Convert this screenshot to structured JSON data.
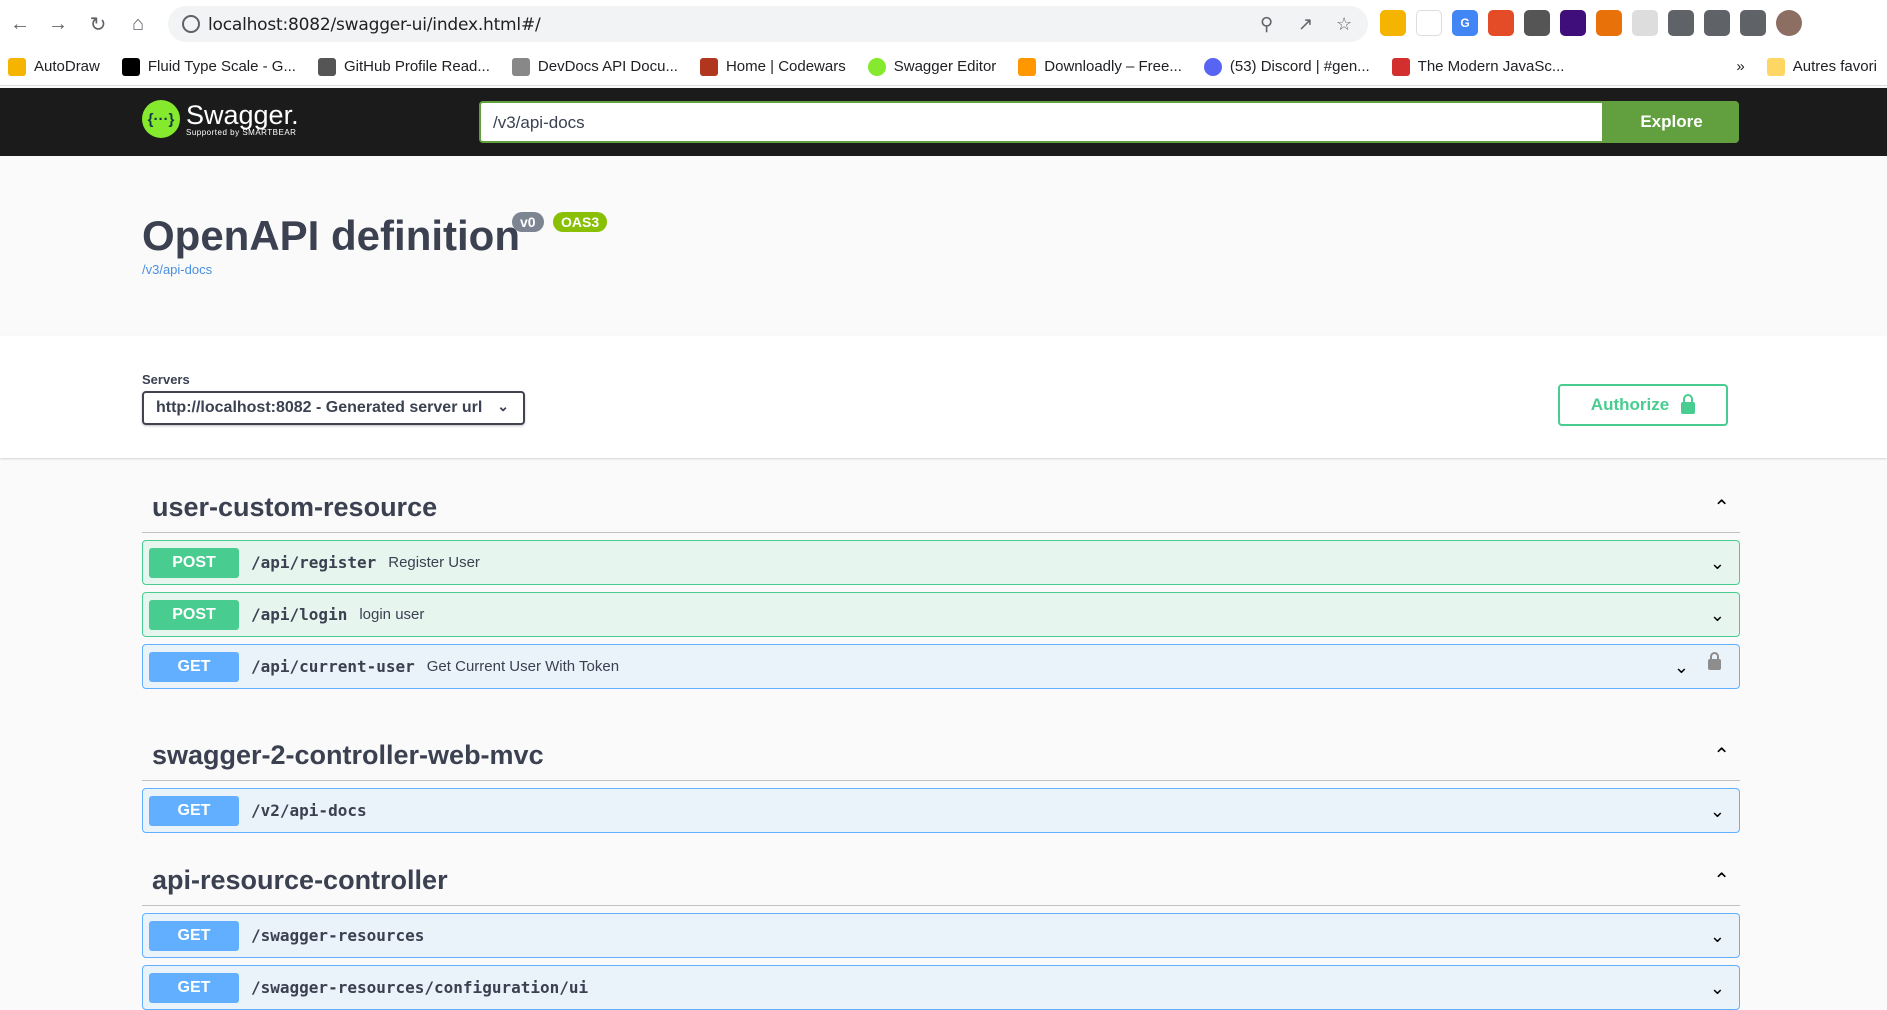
{
  "browser": {
    "url": "localhost:8082/swagger-ui/index.html#/",
    "bookmarks": [
      {
        "label": "AutoDraw",
        "color": "#f4b400"
      },
      {
        "label": "Fluid Type Scale - G...",
        "color": "#000000"
      },
      {
        "label": "GitHub Profile Read...",
        "color": "#555555"
      },
      {
        "label": "DevDocs API Docu...",
        "color": "#888888"
      },
      {
        "label": "Home | Codewars",
        "color": "#b1361e"
      },
      {
        "label": "Swagger Editor",
        "color": "#85ea2d"
      },
      {
        "label": "Downloadly – Free...",
        "color": "#ff9800"
      },
      {
        "label": "(53) Discord | #gen...",
        "color": "#5865f2"
      },
      {
        "label": "The Modern JavaSc...",
        "color": "#d32f2f"
      }
    ],
    "more_bookmarks": "»",
    "other_bookmarks": "Autres favori"
  },
  "swagger_header": {
    "brand": "Swagger.",
    "brand_sub": "Supported by SMARTBEAR",
    "spec_url_value": "/v3/api-docs",
    "explore_label": "Explore"
  },
  "info": {
    "title": "OpenAPI definition",
    "version_badge": "v0",
    "oas_badge": "OAS3",
    "spec_link": "/v3/api-docs"
  },
  "servers": {
    "label": "Servers",
    "selected": "http://localhost:8082 - Generated server url",
    "authorize_label": "Authorize"
  },
  "tags": [
    {
      "name": "user-custom-resource",
      "operations": [
        {
          "method": "POST",
          "path": "/api/register",
          "summary": "Register User",
          "locked": false
        },
        {
          "method": "POST",
          "path": "/api/login",
          "summary": "login user",
          "locked": false
        },
        {
          "method": "GET",
          "path": "/api/current-user",
          "summary": "Get Current User With Token",
          "locked": true
        }
      ]
    },
    {
      "name": "swagger-2-controller-web-mvc",
      "operations": [
        {
          "method": "GET",
          "path": "/v2/api-docs",
          "summary": "",
          "locked": false
        }
      ]
    },
    {
      "name": "api-resource-controller",
      "operations": [
        {
          "method": "GET",
          "path": "/swagger-resources",
          "summary": "",
          "locked": false
        },
        {
          "method": "GET",
          "path": "/swagger-resources/configuration/ui",
          "summary": "",
          "locked": false
        }
      ]
    }
  ]
}
